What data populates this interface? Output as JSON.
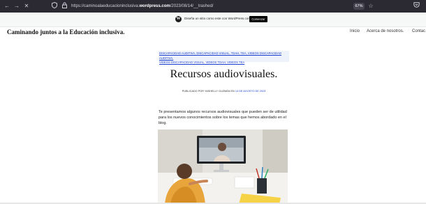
{
  "browser": {
    "url_prefix": "https://caminoalaeducacioninclusiva.",
    "url_domain": "wordpress.com",
    "url_suffix": "/2023/08/14/__trashed/",
    "zoom": "67%"
  },
  "wp_banner": {
    "text": "Diseña un sitio como este con WordPress.com",
    "button": "Comenzar"
  },
  "site": {
    "title": "Caminando juntos a la Educación inclusiva.",
    "nav": [
      "Inicio",
      "Acerca de nosotros.",
      "Contac"
    ]
  },
  "post": {
    "categories_line1": "DISCAPACIDAD AUDITIVA, DISCAPACIDAD VISUAL, TDAH, TEA, VIDEOS DISCAPACIDAD AUDITIVA,",
    "categories_line2": "VIDEOS DISCAPACIDAD VISUAL, VIDEOS TDAH, VIDEOS TEA",
    "title": "Recursos audiovisuales.",
    "byline_prefix": "PUBLICADO POR YASHELLY GUZMÁN EN",
    "byline_date": "14 DE AGOSTO DE 2023",
    "excerpt": "Te presentamos algunos recursos audiovisuales que pueden ser de utilidad para los nuevos conocimientos sobre los temas que hemos abordado en el blog."
  },
  "colors": {
    "toolbar": "#2b2a33",
    "link": "#1a3fd0"
  }
}
